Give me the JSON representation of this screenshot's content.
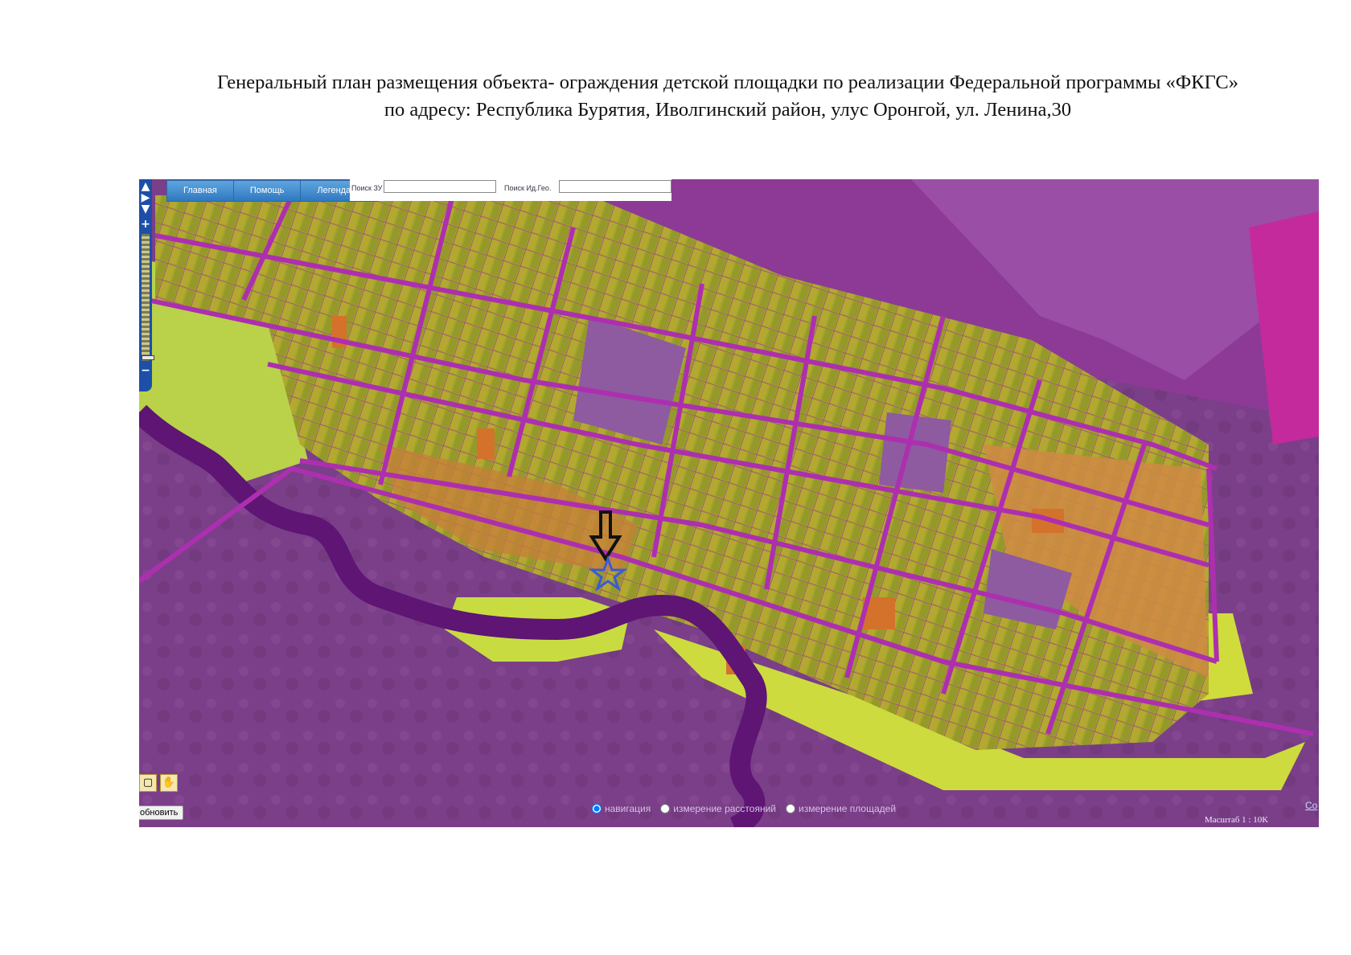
{
  "title": {
    "line1": "Генеральный план размещения объекта- ограждения детской площадки по реализации Федеральной программы «ФКГС»",
    "line2": "по адресу: Республика Бурятия, Иволгинский район, улус Оронгой, ул. Ленина,30"
  },
  "toolbar": {
    "home_label": "Главная",
    "help_label": "Помощь",
    "legend_label": "Легенда"
  },
  "search": {
    "parcel_label": "Поиск ЗУ",
    "parcel_value": "",
    "geo_label": "Поиск Ид.Гео.",
    "geo_value": ""
  },
  "zoom": {
    "plus": "+",
    "minus": "−"
  },
  "refresh_label": "обновить",
  "modes": {
    "navigation": "навигация",
    "distance": "измерение расстояний",
    "area": "измерение площадей",
    "selected": "navigation"
  },
  "scale_text": "Масштаб 1 : 10K",
  "corner_link": "Со",
  "colors": {
    "road": "#a82aa8",
    "residential": "#9fa42a",
    "orange_plot": "#d4722c",
    "light_plot": "#c9d83c",
    "field": "#8a4f8f",
    "river": "#6b1f7d",
    "marker_star": "#3c59d8",
    "marker_arrow": "#111111"
  },
  "markers": {
    "arrow_icon": "down-arrow-icon",
    "star_icon": "star-icon"
  }
}
